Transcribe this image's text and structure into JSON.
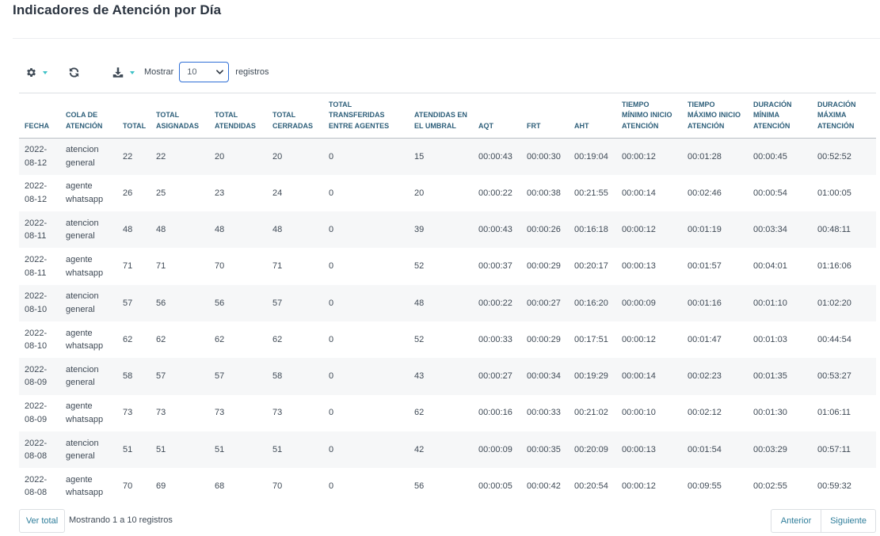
{
  "page": {
    "title": "Indicadores de Atención por Día"
  },
  "toolbar": {
    "mostrar_label": "Mostrar",
    "page_size": "10",
    "registros_label": "registros",
    "icons": {
      "settings": "gear-icon",
      "refresh": "refresh-icon",
      "export": "download-icon"
    },
    "accent_color": "#3ec1c7"
  },
  "table": {
    "headers": [
      [
        "FECHA"
      ],
      [
        "COLA DE",
        "ATENCIÓN"
      ],
      [
        "TOTAL"
      ],
      [
        "TOTAL",
        "ASIGNADAS"
      ],
      [
        "TOTAL",
        "ATENDIDAS"
      ],
      [
        "TOTAL",
        "CERRADAS"
      ],
      [
        "TOTAL",
        "TRANSFERIDAS",
        "ENTRE AGENTES"
      ],
      [
        "ATENDIDAS EN",
        "EL UMBRAL"
      ],
      [
        "AQT"
      ],
      [
        "FRT"
      ],
      [
        "AHT"
      ],
      [
        "TIEMPO",
        "MÍNIMO INICIO",
        "ATENCIÓN"
      ],
      [
        "TIEMPO",
        "MÁXIMO INICIO",
        "ATENCIÓN"
      ],
      [
        "DURACIÓN",
        "MÍNIMA",
        "ATENCIÓN"
      ],
      [
        "DURACIÓN",
        "MÁXIMA",
        "ATENCIÓN"
      ]
    ],
    "rows": [
      [
        [
          "2022-",
          "08-12"
        ],
        [
          "atencion",
          "general"
        ],
        "22",
        "22",
        "20",
        "20",
        "0",
        "15",
        "00:00:43",
        "00:00:30",
        "00:19:04",
        "00:00:12",
        "00:01:28",
        "00:00:45",
        "00:52:52"
      ],
      [
        [
          "2022-",
          "08-12"
        ],
        [
          "agente",
          "whatsapp"
        ],
        "26",
        "25",
        "23",
        "24",
        "0",
        "20",
        "00:00:22",
        "00:00:38",
        "00:21:55",
        "00:00:14",
        "00:02:46",
        "00:00:54",
        "01:00:05"
      ],
      [
        [
          "2022-",
          "08-11"
        ],
        [
          "atencion",
          "general"
        ],
        "48",
        "48",
        "48",
        "48",
        "0",
        "39",
        "00:00:43",
        "00:00:26",
        "00:16:18",
        "00:00:12",
        "00:01:19",
        "00:03:34",
        "00:48:11"
      ],
      [
        [
          "2022-",
          "08-11"
        ],
        [
          "agente",
          "whatsapp"
        ],
        "71",
        "71",
        "70",
        "71",
        "0",
        "52",
        "00:00:37",
        "00:00:29",
        "00:20:17",
        "00:00:13",
        "00:01:57",
        "00:04:01",
        "01:16:06"
      ],
      [
        [
          "2022-",
          "08-10"
        ],
        [
          "atencion",
          "general"
        ],
        "57",
        "56",
        "56",
        "57",
        "0",
        "48",
        "00:00:22",
        "00:00:27",
        "00:16:20",
        "00:00:09",
        "00:01:16",
        "00:01:10",
        "01:02:20"
      ],
      [
        [
          "2022-",
          "08-10"
        ],
        [
          "agente",
          "whatsapp"
        ],
        "62",
        "62",
        "62",
        "62",
        "0",
        "52",
        "00:00:33",
        "00:00:29",
        "00:17:51",
        "00:00:12",
        "00:01:47",
        "00:01:03",
        "00:44:54"
      ],
      [
        [
          "2022-",
          "08-09"
        ],
        [
          "atencion",
          "general"
        ],
        "58",
        "57",
        "57",
        "58",
        "0",
        "43",
        "00:00:27",
        "00:00:34",
        "00:19:29",
        "00:00:14",
        "00:02:23",
        "00:01:35",
        "00:53:27"
      ],
      [
        [
          "2022-",
          "08-09"
        ],
        [
          "agente",
          "whatsapp"
        ],
        "73",
        "73",
        "73",
        "73",
        "0",
        "62",
        "00:00:16",
        "00:00:33",
        "00:21:02",
        "00:00:10",
        "00:02:12",
        "00:01:30",
        "01:06:11"
      ],
      [
        [
          "2022-",
          "08-08"
        ],
        [
          "atencion",
          "general"
        ],
        "51",
        "51",
        "51",
        "51",
        "0",
        "42",
        "00:00:09",
        "00:00:35",
        "00:20:09",
        "00:00:13",
        "00:01:54",
        "00:03:29",
        "00:57:11"
      ],
      [
        [
          "2022-",
          "08-08"
        ],
        [
          "agente",
          "whatsapp"
        ],
        "70",
        "69",
        "68",
        "70",
        "0",
        "56",
        "00:00:05",
        "00:00:42",
        "00:20:54",
        "00:00:12",
        "00:09:55",
        "00:02:55",
        "00:59:32"
      ]
    ]
  },
  "footer": {
    "ver_total": "Ver total",
    "showing": "Mostrando 1 a 10 registros",
    "prev": "Anterior",
    "next": "Siguiente"
  }
}
